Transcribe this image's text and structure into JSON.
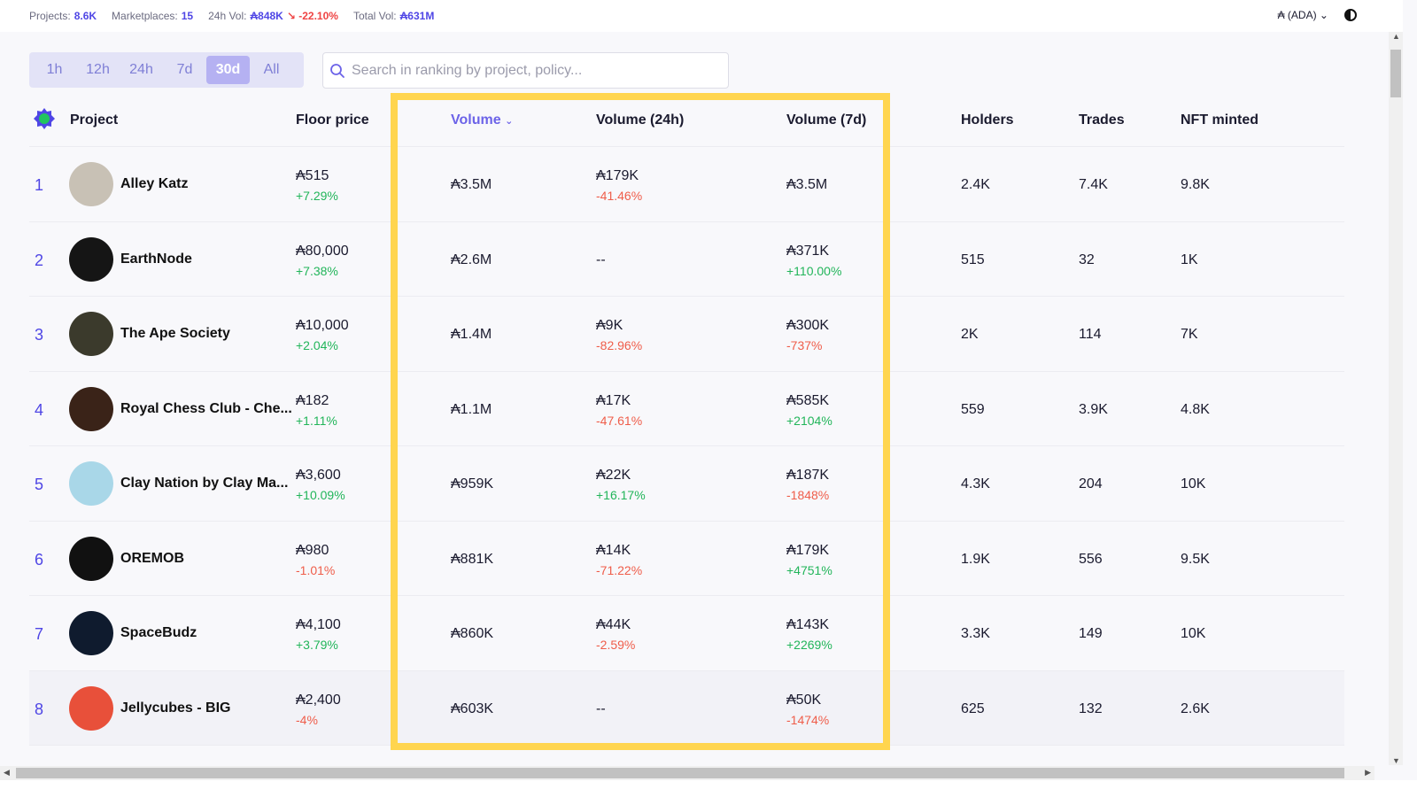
{
  "topbar": {
    "projects_label": "Projects:",
    "projects_value": "8.6K",
    "marketplaces_label": "Marketplaces:",
    "marketplaces_value": "15",
    "vol24_label": "24h Vol:",
    "vol24_value": "₳848K",
    "vol24_change": "↘ -22.10%",
    "total_label": "Total Vol:",
    "total_value": "₳631M",
    "currency": "₳ (ADA) ⌄"
  },
  "periods": [
    "1h",
    "12h",
    "24h",
    "7d",
    "30d",
    "All"
  ],
  "active_period": "30d",
  "search": {
    "placeholder": "Search in ranking by project, policy..."
  },
  "columns": {
    "project": "Project",
    "floor": "Floor price",
    "volume": "Volume",
    "volume24": "Volume (24h)",
    "volume7": "Volume (7d)",
    "holders": "Holders",
    "trades": "Trades",
    "minted": "NFT minted"
  },
  "rows": [
    {
      "rank": "1",
      "name": "Alley Katz",
      "floor": "₳515",
      "floor_chg": "+7.29%",
      "floor_dir": "pos",
      "volume": "₳3.5M",
      "v24": "₳179K",
      "v24_chg": "-41.46%",
      "v24_dir": "neg",
      "v7": "₳3.5M",
      "v7_chg": "",
      "v7_dir": "",
      "holders": "2.4K",
      "trades": "7.4K",
      "minted": "9.8K",
      "avatar_color": "#c8c1b5"
    },
    {
      "rank": "2",
      "name": "EarthNode",
      "floor": "₳80,000",
      "floor_chg": "+7.38%",
      "floor_dir": "pos",
      "volume": "₳2.6M",
      "v24": "--",
      "v24_chg": "",
      "v24_dir": "",
      "v7": "₳371K",
      "v7_chg": "+110.00%",
      "v7_dir": "pos",
      "holders": "515",
      "trades": "32",
      "minted": "1K",
      "avatar_color": "#151515"
    },
    {
      "rank": "3",
      "name": "The Ape Society",
      "floor": "₳10,000",
      "floor_chg": "+2.04%",
      "floor_dir": "pos",
      "volume": "₳1.4M",
      "v24": "₳9K",
      "v24_chg": "-82.96%",
      "v24_dir": "neg",
      "v7": "₳300K",
      "v7_chg": "-737%",
      "v7_dir": "neg",
      "holders": "2K",
      "trades": "114",
      "minted": "7K",
      "avatar_color": "#3b3a2c"
    },
    {
      "rank": "4",
      "name": "Royal Chess Club - Che...",
      "floor": "₳182",
      "floor_chg": "+1.11%",
      "floor_dir": "pos",
      "volume": "₳1.1M",
      "v24": "₳17K",
      "v24_chg": "-47.61%",
      "v24_dir": "neg",
      "v7": "₳585K",
      "v7_chg": "+2104%",
      "v7_dir": "pos",
      "holders": "559",
      "trades": "3.9K",
      "minted": "4.8K",
      "avatar_color": "#3a2318"
    },
    {
      "rank": "5",
      "name": "Clay Nation by Clay Ma...",
      "floor": "₳3,600",
      "floor_chg": "+10.09%",
      "floor_dir": "pos",
      "volume": "₳959K",
      "v24": "₳22K",
      "v24_chg": "+16.17%",
      "v24_dir": "pos",
      "v7": "₳187K",
      "v7_chg": "-1848%",
      "v7_dir": "neg",
      "holders": "4.3K",
      "trades": "204",
      "minted": "10K",
      "avatar_color": "#a9d7e8"
    },
    {
      "rank": "6",
      "name": "OREMOB",
      "floor": "₳980",
      "floor_chg": "-1.01%",
      "floor_dir": "neg",
      "volume": "₳881K",
      "v24": "₳14K",
      "v24_chg": "-71.22%",
      "v24_dir": "neg",
      "v7": "₳179K",
      "v7_chg": "+4751%",
      "v7_dir": "pos",
      "holders": "1.9K",
      "trades": "556",
      "minted": "9.5K",
      "avatar_color": "#111111"
    },
    {
      "rank": "7",
      "name": "SpaceBudz",
      "floor": "₳4,100",
      "floor_chg": "+3.79%",
      "floor_dir": "pos",
      "volume": "₳860K",
      "v24": "₳44K",
      "v24_chg": "-2.59%",
      "v24_dir": "neg",
      "v7": "₳143K",
      "v7_chg": "+2269%",
      "v7_dir": "pos",
      "holders": "3.3K",
      "trades": "149",
      "minted": "10K",
      "avatar_color": "#0f1b2e"
    },
    {
      "rank": "8",
      "name": "Jellycubes - BIG",
      "floor": "₳2,400",
      "floor_chg": "-4%",
      "floor_dir": "neg",
      "volume": "₳603K",
      "v24": "--",
      "v24_chg": "",
      "v24_dir": "",
      "v7": "₳50K",
      "v7_chg": "-1474%",
      "v7_dir": "neg",
      "holders": "625",
      "trades": "132",
      "minted": "2.6K",
      "avatar_color": "#e8503a"
    }
  ]
}
